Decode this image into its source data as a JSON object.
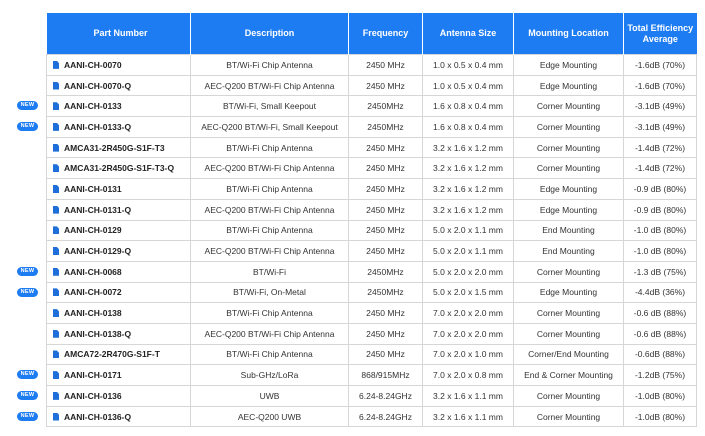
{
  "headers": [
    "Part Number",
    "Description",
    "Frequency",
    "Antenna Size",
    "Mounting Location",
    "Total Efficiency Average"
  ],
  "badge_label": "NEW",
  "rows": [
    {
      "part": "AANI-CH-0070",
      "desc": "BT/Wi-Fi Chip Antenna",
      "freq": "2450 MHz",
      "size": "1.0 x 0.5 x 0.4 mm",
      "mount": "Edge Mounting",
      "eff": "-1.6dB (70%)",
      "new": false
    },
    {
      "part": "AANI-CH-0070-Q",
      "desc": "AEC-Q200 BT/Wi-Fi Chip Antenna",
      "freq": "2450 MHz",
      "size": "1.0 x 0.5 x 0.4 mm",
      "mount": "Edge Mounting",
      "eff": "-1.6dB (70%)",
      "new": false
    },
    {
      "part": "AANI-CH-0133",
      "desc": "BT/Wi-Fi, Small Keepout",
      "freq": "2450MHz",
      "size": "1.6 x 0.8 x 0.4 mm",
      "mount": "Corner Mounting",
      "eff": "-3.1dB (49%)",
      "new": true
    },
    {
      "part": "AANI-CH-0133-Q",
      "desc": "AEC-Q200 BT/Wi-Fi, Small Keepout",
      "freq": "2450MHz",
      "size": "1.6 x 0.8 x 0.4 mm",
      "mount": "Corner Mounting",
      "eff": "-3.1dB (49%)",
      "new": true
    },
    {
      "part": "AMCA31-2R450G-S1F-T3",
      "desc": "BT/Wi-Fi Chip Antenna",
      "freq": "2450 MHz",
      "size": "3.2 x 1.6 x 1.2 mm",
      "mount": "Corner Mounting",
      "eff": "-1.4dB (72%)",
      "new": false
    },
    {
      "part": "AMCA31-2R450G-S1F-T3-Q",
      "desc": "AEC-Q200 BT/Wi-Fi Chip Antenna",
      "freq": "2450 MHz",
      "size": "3.2 x 1.6 x 1.2 mm",
      "mount": "Corner Mounting",
      "eff": "-1.4dB (72%)",
      "new": false
    },
    {
      "part": "AANI-CH-0131",
      "desc": "BT/Wi-Fi Chip Antenna",
      "freq": "2450 MHz",
      "size": "3.2 x 1.6 x 1.2 mm",
      "mount": "Edge Mounting",
      "eff": "-0.9 dB (80%)",
      "new": false
    },
    {
      "part": "AANI-CH-0131-Q",
      "desc": "AEC-Q200 BT/Wi-Fi Chip Antenna",
      "freq": "2450 MHz",
      "size": "3.2 x 1.6 x 1.2 mm",
      "mount": "Edge Mounting",
      "eff": "-0.9 dB (80%)",
      "new": false
    },
    {
      "part": "AANI-CH-0129",
      "desc": "BT/Wi-Fi Chip Antenna",
      "freq": "2450 MHz",
      "size": "5.0 x 2.0 x 1.1 mm",
      "mount": "End Mounting",
      "eff": "-1.0 dB (80%)",
      "new": false
    },
    {
      "part": "AANI-CH-0129-Q",
      "desc": "AEC-Q200 BT/Wi-Fi Chip Antenna",
      "freq": "2450 MHz",
      "size": "5.0 x 2.0 x 1.1 mm",
      "mount": "End Mounting",
      "eff": "-1.0 dB (80%)",
      "new": false
    },
    {
      "part": "AANI-CH-0068",
      "desc": "BT/Wi-Fi",
      "freq": "2450MHz",
      "size": "5.0 x 2.0 x 2.0 mm",
      "mount": "Corner Mounting",
      "eff": "-1.3 dB (75%)",
      "new": true
    },
    {
      "part": "AANI-CH-0072",
      "desc": "BT/Wi-Fi, On-Metal",
      "freq": "2450MHz",
      "size": "5.0 x 2.0 x 1.5 mm",
      "mount": "Edge Mounting",
      "eff": "-4.4dB (36%)",
      "new": true
    },
    {
      "part": "AANI-CH-0138",
      "desc": "BT/Wi-Fi Chip Antenna",
      "freq": "2450 MHz",
      "size": "7.0 x 2.0 x 2.0 mm",
      "mount": "Corner Mounting",
      "eff": "-0.6 dB (88%)",
      "new": false
    },
    {
      "part": "AANI-CH-0138-Q",
      "desc": "AEC-Q200 BT/Wi-Fi Chip Antenna",
      "freq": "2450 MHz",
      "size": "7.0 x 2.0 x 2.0 mm",
      "mount": "Corner Mounting",
      "eff": "-0.6 dB (88%)",
      "new": false
    },
    {
      "part": "AMCA72-2R470G-S1F-T",
      "desc": "BT/Wi-Fi Chip Antenna",
      "freq": "2450 MHz",
      "size": "7.0 x 2.0 x 1.0 mm",
      "mount": "Corner/End Mounting",
      "eff": "-0.6dB (88%)",
      "new": false
    },
    {
      "part": "AANI-CH-0171",
      "desc": "Sub-GHz/LoRa",
      "freq": "868/915MHz",
      "size": "7.0 x 2.0 x 0.8 mm",
      "mount": "End & Corner Mounting",
      "eff": "-1.2dB (75%)",
      "new": true
    },
    {
      "part": "AANI-CH-0136",
      "desc": "UWB",
      "freq": "6.24-8.24GHz",
      "size": "3.2 x 1.6 x 1.1 mm",
      "mount": "Corner Mounting",
      "eff": "-1.0dB (80%)",
      "new": true
    },
    {
      "part": "AANI-CH-0136-Q",
      "desc": "AEC-Q200 UWB",
      "freq": "6.24-8.24GHz",
      "size": "3.2 x 1.6 x 1.1 mm",
      "mount": "Corner Mounting",
      "eff": "-1.0dB (80%)",
      "new": true
    }
  ]
}
